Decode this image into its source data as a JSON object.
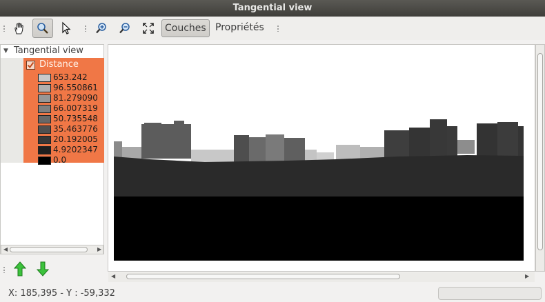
{
  "window": {
    "title": "Tangential view"
  },
  "toolbar": {
    "pan_icon": "hand-pan-icon",
    "zoom_tool_icon": "magnifier-icon",
    "select_icon": "pointer-arrow-icon",
    "zoom_in_icon": "zoom-in-icon",
    "zoom_out_icon": "zoom-out-icon",
    "zoom_full_icon": "zoom-extent-icon",
    "layers_label": "Couches",
    "properties_label": "Propriétés"
  },
  "layer_tree": {
    "root_label": "Tangential view",
    "layer": {
      "name": "Distance",
      "checked": true,
      "highlight_color": "#f07746",
      "legend": [
        {
          "label": "653.242",
          "color": "#c9c9c9"
        },
        {
          "label": "96.550861",
          "color": "#b0b0b0"
        },
        {
          "label": "81.279090",
          "color": "#979797"
        },
        {
          "label": "66.007319",
          "color": "#7f7f7f"
        },
        {
          "label": "50.735548",
          "color": "#676767"
        },
        {
          "label": "35.463776",
          "color": "#4f4f4f"
        },
        {
          "label": "20.192005",
          "color": "#373737"
        },
        {
          "label": "4.9202347",
          "color": "#1f1f1f"
        },
        {
          "label": "0.0",
          "color": "#000000"
        }
      ]
    }
  },
  "panel_buttons": {
    "move_up_icon": "green-arrow-up-icon",
    "move_down_icon": "green-arrow-down-icon"
  },
  "status": {
    "coordinates": "X: 185,395 - Y : -59,332"
  }
}
